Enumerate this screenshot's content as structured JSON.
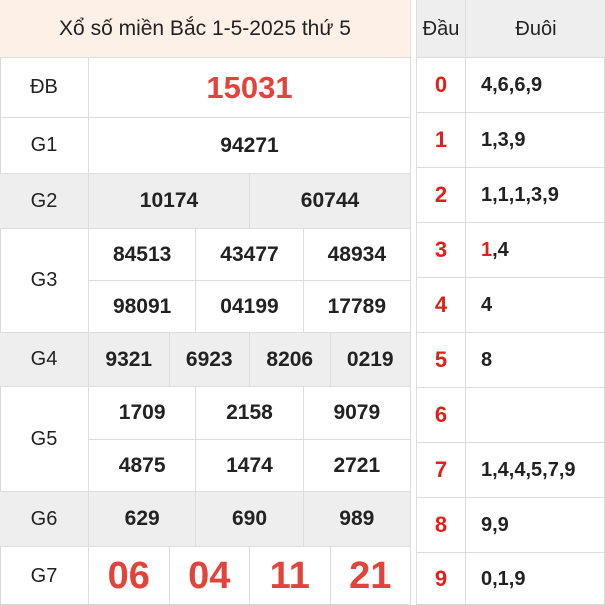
{
  "title": "Xổ số miền Bắc 1-5-2025 thứ 5",
  "prizes": {
    "db": {
      "label": "ĐB",
      "numbers": [
        "15031"
      ]
    },
    "g1": {
      "label": "G1",
      "numbers": [
        "94271"
      ]
    },
    "g2": {
      "label": "G2",
      "numbers": [
        "10174",
        "60744"
      ]
    },
    "g3": {
      "label": "G3",
      "numbers": [
        "84513",
        "43477",
        "48934",
        "98091",
        "04199",
        "17789"
      ]
    },
    "g4": {
      "label": "G4",
      "numbers": [
        "9321",
        "6923",
        "8206",
        "0219"
      ]
    },
    "g5": {
      "label": "G5",
      "numbers": [
        "1709",
        "2158",
        "9079",
        "4875",
        "1474",
        "2721"
      ]
    },
    "g6": {
      "label": "G6",
      "numbers": [
        "629",
        "690",
        "989"
      ]
    },
    "g7": {
      "label": "G7",
      "numbers": [
        "06",
        "04",
        "11",
        "21"
      ]
    }
  },
  "loto": {
    "header_dau": "Đầu",
    "header_duoi": "Đuôi",
    "rows": [
      {
        "dau": "0",
        "duoi_hl": "",
        "duoi": "4,6,6,9"
      },
      {
        "dau": "1",
        "duoi_hl": "",
        "duoi": "1,3,9"
      },
      {
        "dau": "2",
        "duoi_hl": "",
        "duoi": "1,1,1,3,9"
      },
      {
        "dau": "3",
        "duoi_hl": "1",
        "duoi": ",4"
      },
      {
        "dau": "4",
        "duoi_hl": "",
        "duoi": "4"
      },
      {
        "dau": "5",
        "duoi_hl": "",
        "duoi": "8"
      },
      {
        "dau": "6",
        "duoi_hl": "",
        "duoi": ""
      },
      {
        "dau": "7",
        "duoi_hl": "",
        "duoi": "1,4,4,5,7,9"
      },
      {
        "dau": "8",
        "duoi_hl": "",
        "duoi": "9,9"
      },
      {
        "dau": "9",
        "duoi_hl": "",
        "duoi": "0,1,9"
      }
    ]
  },
  "colors": {
    "accent_red": "#e0201a",
    "title_bg": "#fdf0e6",
    "shade": "#eeeeee"
  }
}
